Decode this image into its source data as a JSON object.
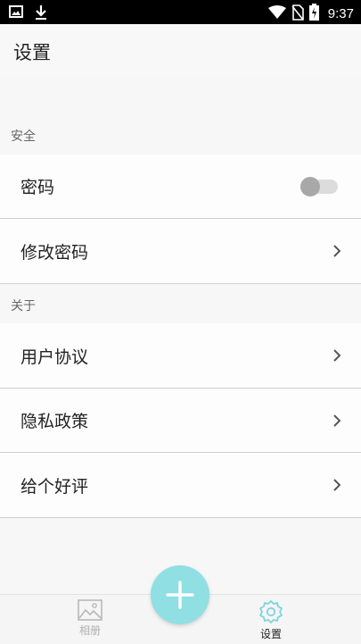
{
  "status_bar": {
    "time": "9:37",
    "icons": [
      "image-icon",
      "download-icon",
      "wifi-icon",
      "no-sim-icon",
      "battery-charging-icon"
    ]
  },
  "header": {
    "title": "设置"
  },
  "sections": {
    "security": {
      "label": "安全",
      "items": [
        {
          "label": "密码",
          "control": "toggle",
          "toggle_on": false
        },
        {
          "label": "修改密码",
          "control": "chevron"
        }
      ]
    },
    "about": {
      "label": "关于",
      "items": [
        {
          "label": "用户协议",
          "control": "chevron"
        },
        {
          "label": "隐私政策",
          "control": "chevron"
        },
        {
          "label": "给个好评",
          "control": "chevron"
        }
      ]
    }
  },
  "bottom_nav": {
    "items": [
      {
        "label": "相册",
        "icon": "image-icon",
        "active": false
      },
      {
        "label": "设置",
        "icon": "gear-icon",
        "active": true
      }
    ],
    "fab_icon": "plus-icon"
  },
  "colors": {
    "accent": "#8fdfe3",
    "active_icon": "#7fd3dc",
    "inactive": "#b0b0b0"
  }
}
